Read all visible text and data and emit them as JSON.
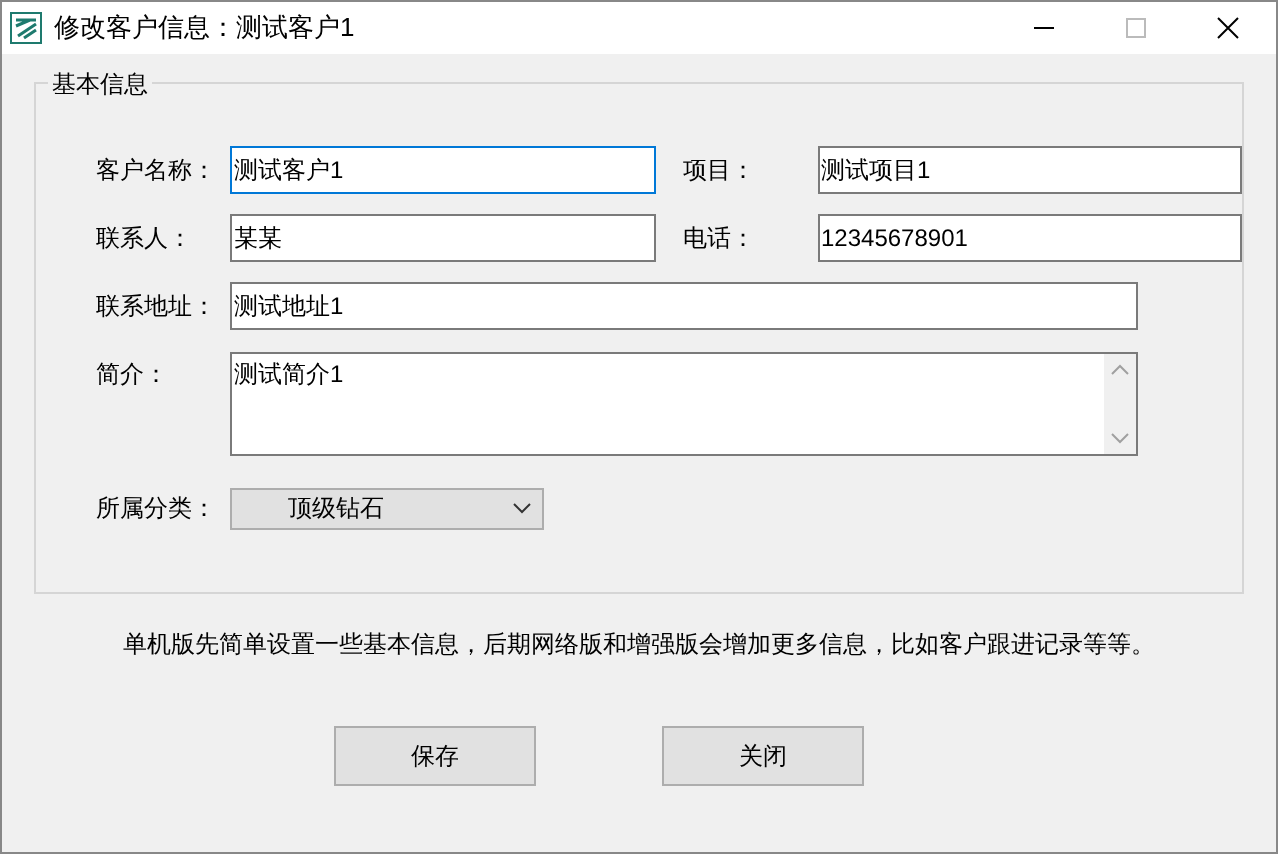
{
  "window": {
    "title": "修改客户信息：测试客户1"
  },
  "group": {
    "title": "基本信息"
  },
  "rows": [
    {
      "fields": [
        {
          "label": "客户名称：",
          "value": "测试客户1",
          "focused": true
        },
        {
          "label": "项目：",
          "value": "测试项目1",
          "focused": false
        }
      ]
    },
    {
      "fields": [
        {
          "label": "联系人：",
          "value": "某某",
          "focused": false
        },
        {
          "label": "电话：",
          "value": "12345678901",
          "focused": false
        }
      ]
    },
    {
      "fields": [
        {
          "label": "联系地址：",
          "value": "测试地址1",
          "focused": false
        }
      ]
    }
  ],
  "intro": {
    "label": "简介：",
    "value": "测试简介1"
  },
  "category": {
    "label": "所属分类：",
    "value": "顶级钻石"
  },
  "note": "单机版先简单设置一些基本信息，后期网络版和增强版会增加更多信息，比如客户跟进记录等等。",
  "buttons": [
    "保存",
    "关闭"
  ]
}
